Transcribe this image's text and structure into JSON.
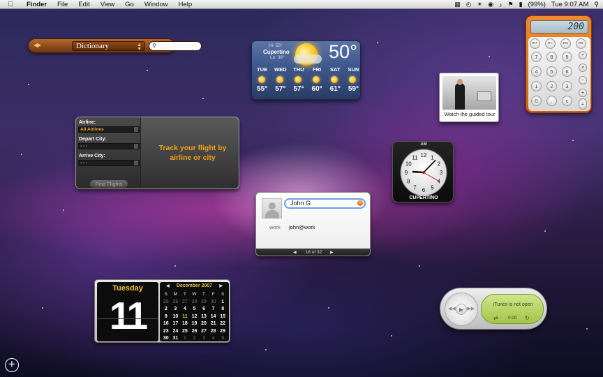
{
  "menubar": {
    "app": "Finder",
    "items": [
      "File",
      "Edit",
      "View",
      "Go",
      "Window",
      "Help"
    ],
    "battery": "(99%)",
    "clock": "Tue 9:07 AM"
  },
  "dictionary": {
    "source": "Dictionary",
    "search_value": ""
  },
  "weather": {
    "hi": "Hi: 55°",
    "city": "Cupertino",
    "lo": "Lo: 36°",
    "current_temp": "50°",
    "forecast": [
      {
        "day": "TUE",
        "temp": "55°"
      },
      {
        "day": "WED",
        "temp": "57°"
      },
      {
        "day": "THU",
        "temp": "57°"
      },
      {
        "day": "FRI",
        "temp": "60°"
      },
      {
        "day": "SAT",
        "temp": "61°"
      },
      {
        "day": "SUN",
        "temp": "59°"
      }
    ]
  },
  "calculator": {
    "display": "200",
    "keys": [
      "m+",
      "m-",
      "mc",
      "mr",
      "÷",
      "7",
      "8",
      "9",
      "×",
      "4",
      "5",
      "6",
      "−",
      "1",
      "2",
      "3",
      "+",
      "0",
      ".",
      "c",
      "="
    ]
  },
  "tour": {
    "caption": "Watch the guided tour"
  },
  "flight": {
    "airline_label": "Airline:",
    "airline_value": "All Airlines",
    "depart_label": "Depart City:",
    "depart_value": "- - -",
    "arrive_label": "Arrive City:",
    "arrive_value": "- - -",
    "find_button": "Find Flights",
    "message_line1": "Track your flight by",
    "message_line2": "airline or city"
  },
  "clock": {
    "ampm": "AM",
    "city": "CUPERTINO",
    "numbers": [
      "12",
      "1",
      "2",
      "3",
      "4",
      "5",
      "6",
      "7",
      "8",
      "9",
      "10",
      "11"
    ],
    "hour": 9,
    "minute": 7,
    "second": 20
  },
  "address": {
    "search_value": "John G",
    "label": "work",
    "value": "john@work",
    "pager": "16 of 32"
  },
  "calendar": {
    "day_name": "Tuesday",
    "day_number": "11",
    "month_title": "December 2007",
    "weekdays": [
      "S",
      "M",
      "T",
      "W",
      "T",
      "F",
      "S"
    ],
    "weeks": [
      [
        "25",
        "26",
        "27",
        "28",
        "29",
        "30",
        "1"
      ],
      [
        "2",
        "3",
        "4",
        "5",
        "6",
        "7",
        "8"
      ],
      [
        "9",
        "10",
        "11",
        "12",
        "13",
        "14",
        "15"
      ],
      [
        "16",
        "17",
        "18",
        "19",
        "20",
        "21",
        "22"
      ],
      [
        "23",
        "24",
        "25",
        "26",
        "27",
        "28",
        "29"
      ],
      [
        "30",
        "31",
        "1",
        "2",
        "3",
        "4",
        "5"
      ]
    ]
  },
  "itunes": {
    "status": "iTunes is not open",
    "time": "0:00"
  },
  "colors": {
    "flight_accent": "#f2a31b",
    "calendar_accent": "#f0c22f",
    "calculator_body": "#e8701a",
    "itunes_lcd": "#b8d45f"
  },
  "icons": {
    "menubar_left": "apple-icon",
    "add_widget": "plus-icon"
  }
}
